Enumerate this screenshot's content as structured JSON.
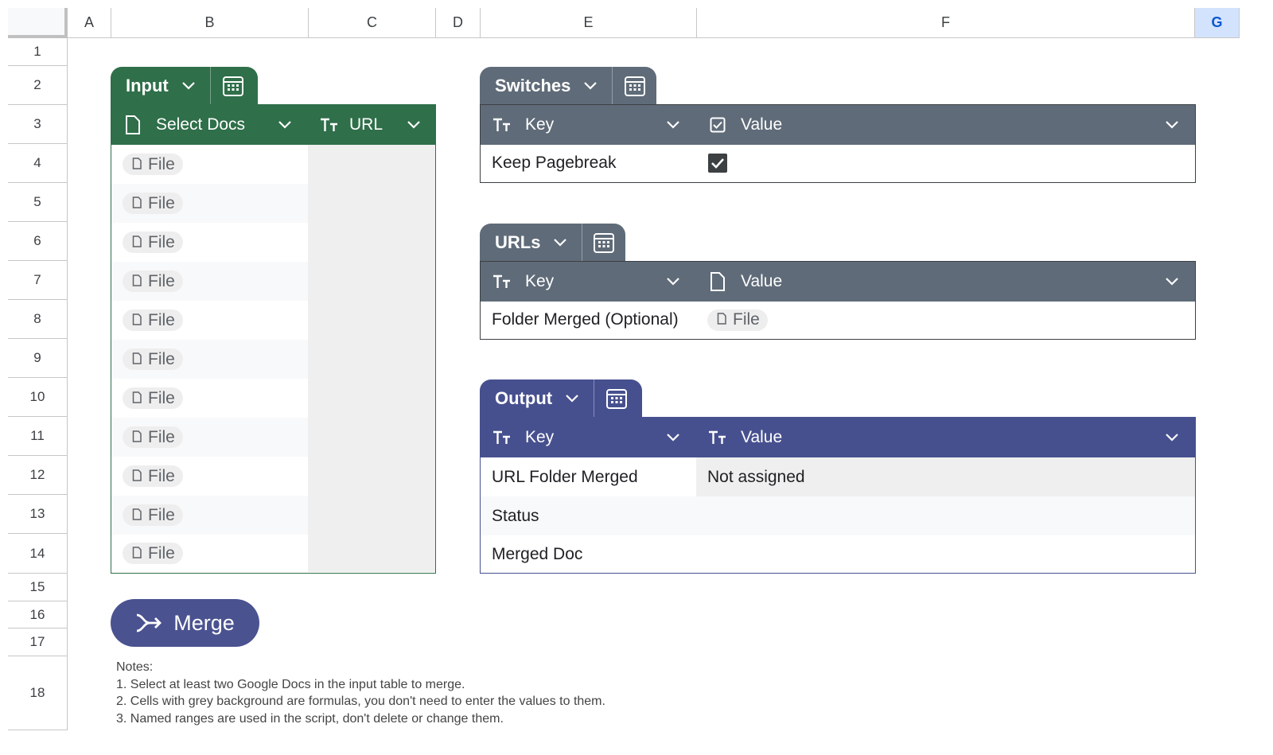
{
  "sheet": {
    "columns": [
      "A",
      "B",
      "C",
      "D",
      "E",
      "F",
      "G"
    ],
    "selected_column": "G",
    "rows": [
      "1",
      "2",
      "3",
      "4",
      "5",
      "6",
      "7",
      "8",
      "9",
      "10",
      "11",
      "12",
      "13",
      "14",
      "15",
      "16",
      "17",
      "18"
    ]
  },
  "input_table": {
    "name": "Input",
    "columns": [
      {
        "label": "Select Docs",
        "type_icon": "file-icon"
      },
      {
        "label": "URL",
        "type_icon": "text-type-icon"
      }
    ],
    "rows": [
      "File",
      "File",
      "File",
      "File",
      "File",
      "File",
      "File",
      "File",
      "File",
      "File",
      "File"
    ],
    "color": "#2f6f4a"
  },
  "switches_table": {
    "name": "Switches",
    "columns": [
      {
        "label": "Key",
        "type_icon": "text-type-icon"
      },
      {
        "label": "Value",
        "type_icon": "checkbox-icon"
      }
    ],
    "rows": [
      {
        "key": "Keep Pagebreak",
        "checked": true
      }
    ],
    "color": "#5f6b78"
  },
  "urls_table": {
    "name": "URLs",
    "columns": [
      {
        "label": "Key",
        "type_icon": "text-type-icon"
      },
      {
        "label": "Value",
        "type_icon": "file-icon"
      }
    ],
    "rows": [
      {
        "key": "Folder Merged (Optional)",
        "value": "File"
      }
    ],
    "color": "#5f6b78"
  },
  "output_table": {
    "name": "Output",
    "columns": [
      {
        "label": "Key",
        "type_icon": "text-type-icon"
      },
      {
        "label": "Value",
        "type_icon": "text-type-icon"
      }
    ],
    "rows": [
      {
        "key": "URL Folder Merged",
        "value": "Not assigned"
      },
      {
        "key": "Status",
        "value": ""
      },
      {
        "key": "Merged Doc",
        "value": ""
      }
    ],
    "color": "#47508f"
  },
  "merge_button": {
    "label": "Merge",
    "icon": "merge-arrow-icon"
  },
  "notes": {
    "title": "Notes:",
    "lines": [
      "1. Select at least two Google Docs in the input table to merge.",
      "2. Cells with grey background are formulas, you don't need to enter the values to them.",
      "3. Named ranges are used in the script, don't delete or change them."
    ]
  }
}
